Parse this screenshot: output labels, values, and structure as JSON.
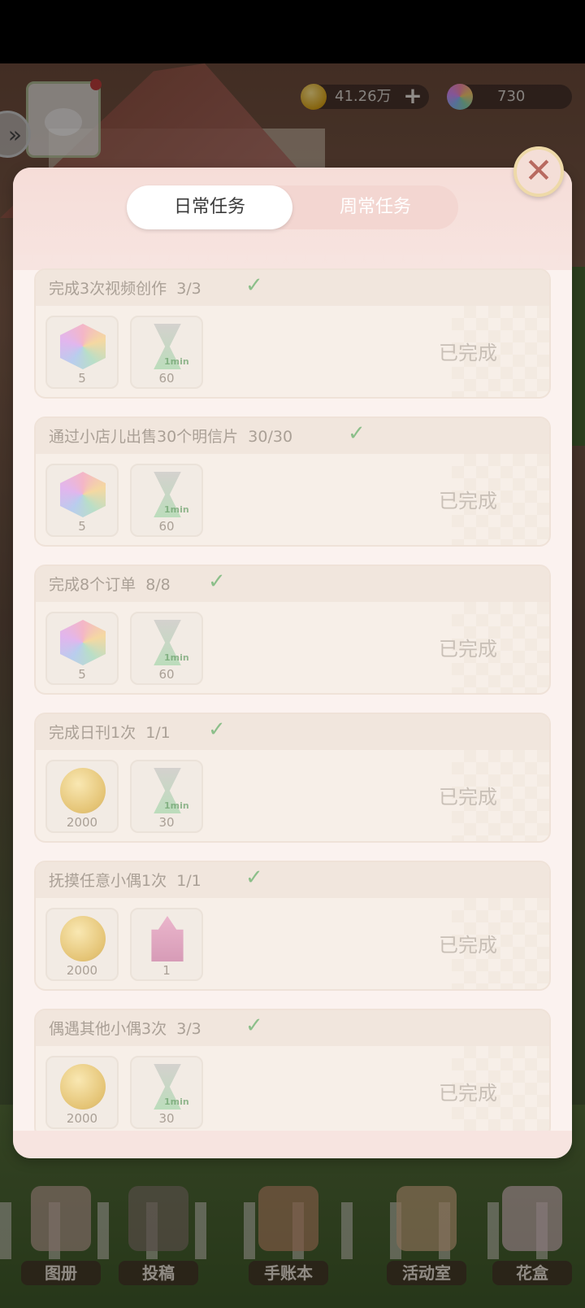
{
  "currency": {
    "gold": {
      "icon": "coin-icon",
      "value": "41.26万"
    },
    "gems": {
      "icon": "gem-icon",
      "value": "730"
    }
  },
  "dialog": {
    "tabs": [
      {
        "label": "日常任务",
        "active": true
      },
      {
        "label": "周常任务",
        "active": false
      }
    ],
    "tasks": [
      {
        "title": "完成3次视频创作",
        "progress": "3/3",
        "status": "已完成",
        "rewards": [
          {
            "icon": "rainbow-gem-icon",
            "count": "5"
          },
          {
            "icon": "hourglass-1min-icon",
            "count": "60"
          }
        ]
      },
      {
        "title": "通过小店儿出售30个明信片",
        "progress": "30/30",
        "status": "已完成",
        "rewards": [
          {
            "icon": "rainbow-gem-icon",
            "count": "5"
          },
          {
            "icon": "hourglass-1min-icon",
            "count": "60"
          }
        ]
      },
      {
        "title": "完成8个订单",
        "progress": "8/8",
        "status": "已完成",
        "rewards": [
          {
            "icon": "rainbow-gem-icon",
            "count": "5"
          },
          {
            "icon": "hourglass-1min-icon",
            "count": "60"
          }
        ]
      },
      {
        "title": "完成日刊1次",
        "progress": "1/1",
        "status": "已完成",
        "rewards": [
          {
            "icon": "gold-coin-icon",
            "count": "2000"
          },
          {
            "icon": "hourglass-1min-icon",
            "count": "30"
          }
        ]
      },
      {
        "title": "抚摸任意小偶1次",
        "progress": "1/1",
        "status": "已完成",
        "rewards": [
          {
            "icon": "gold-coin-icon",
            "count": "2000"
          },
          {
            "icon": "pink-castle-icon",
            "count": "1"
          }
        ]
      },
      {
        "title": "偶遇其他小偶3次",
        "progress": "3/3",
        "status": "已完成",
        "rewards": [
          {
            "icon": "gold-coin-icon",
            "count": "2000"
          },
          {
            "icon": "hourglass-1min-icon",
            "count": "30"
          }
        ]
      }
    ],
    "hourglass_label": "1min"
  },
  "bottom_nav": [
    {
      "label": "图册"
    },
    {
      "label": "投稿"
    },
    {
      "label": "手账本"
    },
    {
      "label": "活动室"
    },
    {
      "label": "花盒"
    }
  ],
  "colors": {
    "dialog_bg": "#fbf2ef",
    "tab_active": "#ffffff",
    "check": "#8cbf8a",
    "completed_text": "#c8bfb6"
  }
}
